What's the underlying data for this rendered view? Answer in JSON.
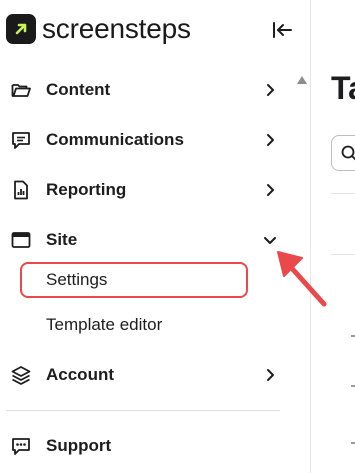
{
  "brand": {
    "name": "screensteps",
    "logo_icon": "arrow-up-right-icon",
    "logo_color": "#c8f25a"
  },
  "sidebar": {
    "items": [
      {
        "label": "Content",
        "icon": "folder-open-icon",
        "expanded": false
      },
      {
        "label": "Communications",
        "icon": "message-square-icon",
        "expanded": false
      },
      {
        "label": "Reporting",
        "icon": "report-chart-icon",
        "expanded": false
      },
      {
        "label": "Site",
        "icon": "browser-window-icon",
        "expanded": true,
        "children": [
          {
            "label": "Settings",
            "active": true
          },
          {
            "label": "Template editor",
            "active": false
          }
        ]
      },
      {
        "label": "Account",
        "icon": "layers-icon",
        "expanded": false
      },
      {
        "label": "Support",
        "icon": "chat-bubble-icon",
        "expanded": false
      }
    ]
  },
  "main": {
    "title": "Ta"
  },
  "colors": {
    "highlight": "#e9494b",
    "text": "#1d1d1f"
  }
}
